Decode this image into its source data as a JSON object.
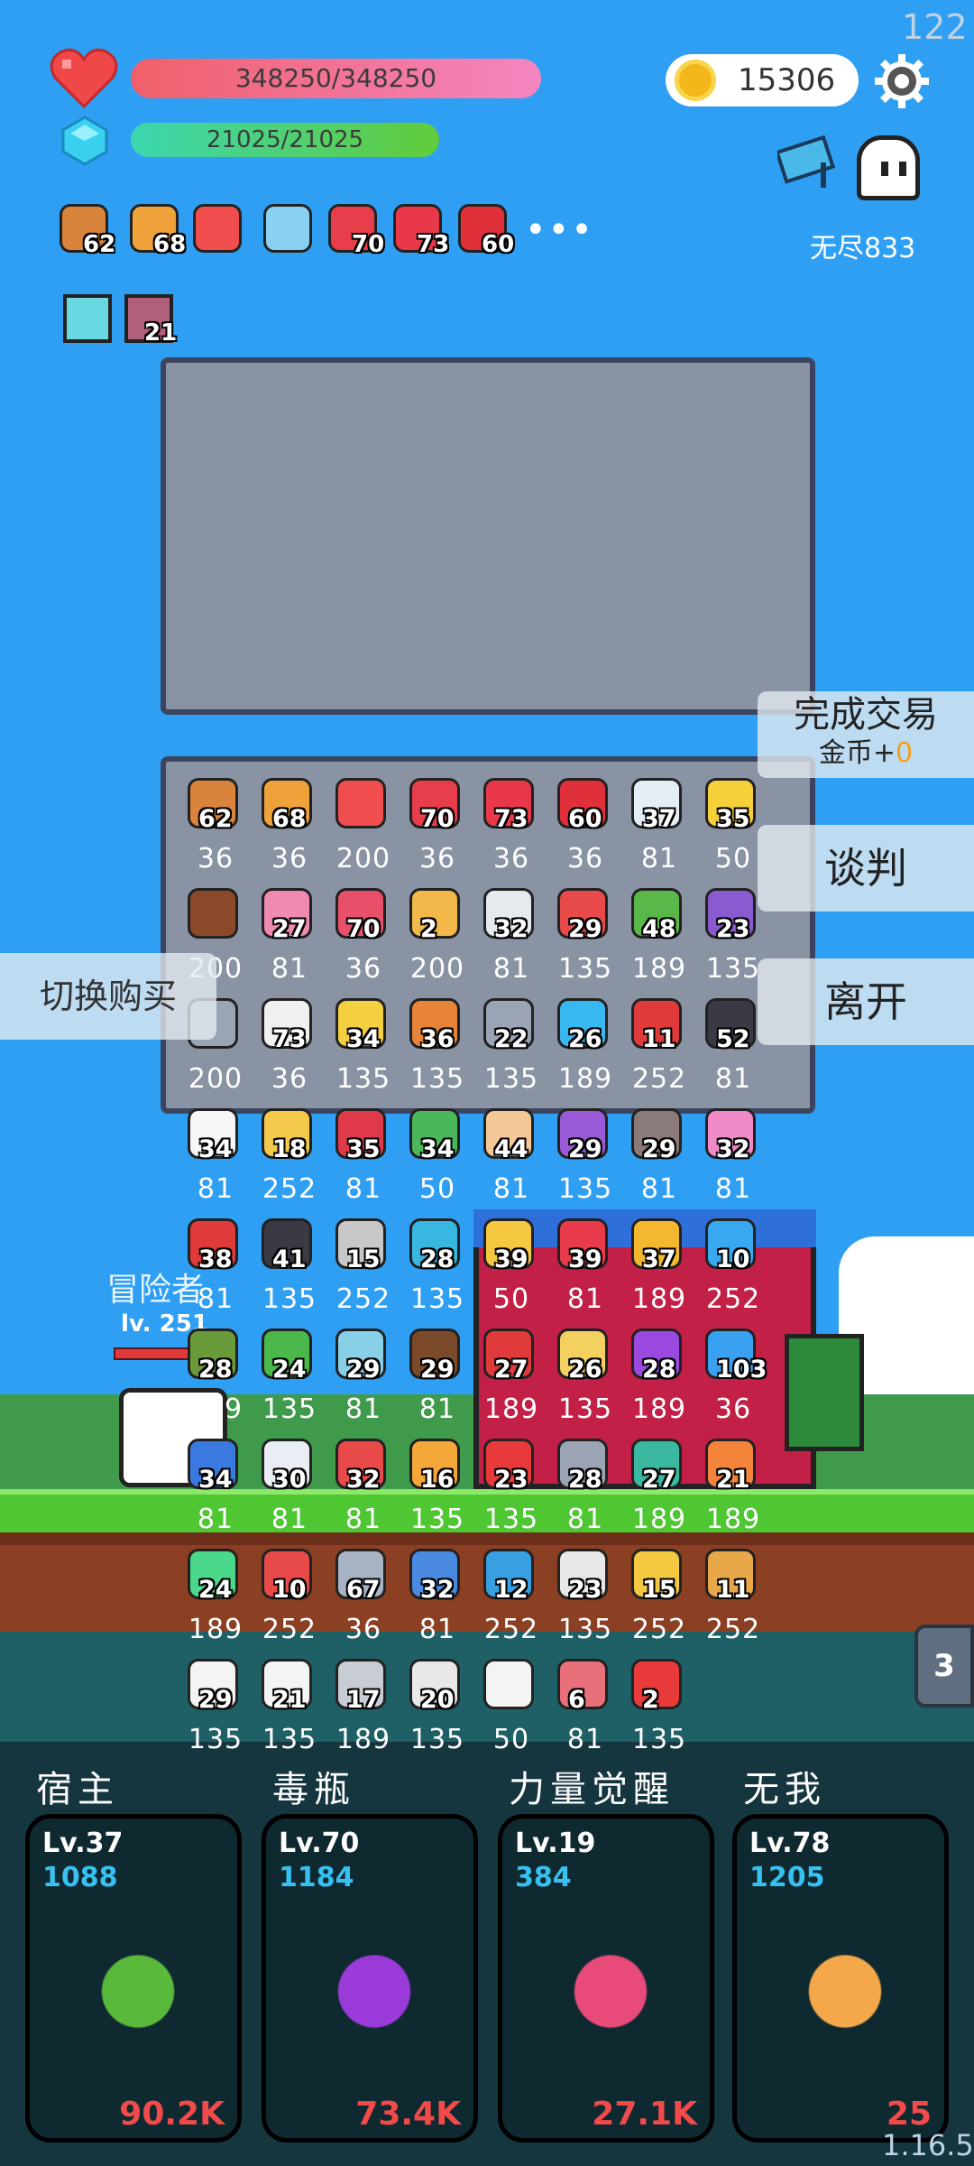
{
  "fps_counter": "122",
  "version": "1.16.5",
  "hp": {
    "text": "348250/348250",
    "current": 348250,
    "max": 348250
  },
  "mp": {
    "text": "21025/21025",
    "current": 21025,
    "max": 21025
  },
  "gold": "15306",
  "endless_label": "无尽833",
  "buffs": [
    {
      "icon": "donut-icon",
      "count": "62"
    },
    {
      "icon": "book-icon",
      "count": "68"
    },
    {
      "icon": "percent-card-icon",
      "count": ""
    },
    {
      "icon": "magnifier-icon",
      "count": ""
    },
    {
      "icon": "watermelon-icon",
      "count": "70"
    },
    {
      "icon": "sock-icon",
      "count": "73"
    },
    {
      "icon": "apple-icon",
      "count": "60"
    }
  ],
  "more_buffs": "•••",
  "status_effects": [
    {
      "icon": "lightbulb-icon",
      "count": ""
    },
    {
      "icon": "sword-card-icon",
      "count": "21"
    }
  ],
  "buttons": {
    "complete_trade": "完成交易",
    "gold_gain_prefix": "金币+",
    "gold_gain_value": "0",
    "negotiate": "谈判",
    "leave": "离开",
    "switch_buy": "切换购买"
  },
  "hero": {
    "name": "冒险者",
    "level": "lv. 251"
  },
  "stage_badge": "3",
  "shop_items": [
    [
      {
        "icon": "donut-icon",
        "count": "62",
        "price": "36",
        "color": "#d9843c"
      },
      {
        "icon": "book-icon",
        "count": "68",
        "price": "36",
        "color": "#f0a23a"
      },
      {
        "icon": "percent-card-icon",
        "count": "",
        "price": "200",
        "color": "#f04e4e"
      },
      {
        "icon": "watermelon-icon",
        "count": "70",
        "price": "36",
        "color": "#e83d4a"
      },
      {
        "icon": "sock-icon",
        "count": "73",
        "price": "36",
        "color": "#e8384a"
      },
      {
        "icon": "apple-icon",
        "count": "60",
        "price": "36",
        "color": "#e0303a"
      },
      {
        "icon": "envelope-icon",
        "count": "37",
        "price": "81",
        "color": "#e6eef5"
      },
      {
        "icon": "sun-cloud-icon",
        "count": "35",
        "price": "50",
        "color": "#f6d03a"
      }
    ],
    [
      {
        "icon": "mushroom-icon",
        "count": "",
        "price": "200",
        "color": "#8a4a2a"
      },
      {
        "icon": "perfume-icon",
        "count": "27",
        "price": "81",
        "color": "#f08ab0"
      },
      {
        "icon": "jam-jar-icon",
        "count": "70",
        "price": "36",
        "color": "#e8506a"
      },
      {
        "icon": "map-scroll-icon",
        "count": "2",
        "price": "200",
        "color": "#f2b84a"
      },
      {
        "icon": "cloud-icon",
        "count": "32",
        "price": "81",
        "color": "#e6e9ee"
      },
      {
        "icon": "pill-icon",
        "count": "29",
        "price": "135",
        "color": "#e84a4a"
      },
      {
        "icon": "green-goblin-icon",
        "count": "48",
        "price": "189",
        "color": "#5ab84a"
      },
      {
        "icon": "star-shield-icon",
        "count": "23",
        "price": "135",
        "color": "#8a5ad0"
      }
    ],
    [
      {
        "icon": "question-mark-icon",
        "count": "",
        "price": "200",
        "color": "#9aa4b4"
      },
      {
        "icon": "flower-icon",
        "count": "73",
        "price": "36",
        "color": "#f0f0f0"
      },
      {
        "icon": "halo-icon",
        "count": "34",
        "price": "135",
        "color": "#f4d040"
      },
      {
        "icon": "sword-flag-icon",
        "count": "36",
        "price": "135",
        "color": "#e8843a"
      },
      {
        "icon": "spiked-ball-icon",
        "count": "22",
        "price": "135",
        "color": "#9aa4b4"
      },
      {
        "icon": "chat-bubble-icon",
        "count": "26",
        "price": "189",
        "color": "#38b8f0"
      },
      {
        "icon": "broken-heart-icon",
        "count": "11",
        "price": "252",
        "color": "#e03a3a"
      },
      {
        "icon": "bat-icon",
        "count": "52",
        "price": "81",
        "color": "#3a3a44"
      }
    ],
    [
      {
        "icon": "fried-egg-icon",
        "count": "34",
        "price": "81",
        "color": "#f6f6f6"
      },
      {
        "icon": "magic-wand-icon",
        "count": "18",
        "price": "252",
        "color": "#f4c84a"
      },
      {
        "icon": "strawberry-icon",
        "count": "35",
        "price": "81",
        "color": "#e03a4a"
      },
      {
        "icon": "money-heart-icon",
        "count": "34",
        "price": "50",
        "color": "#4ab85a"
      },
      {
        "icon": "finger-icon",
        "count": "44",
        "price": "81",
        "color": "#f4c896"
      },
      {
        "icon": "purple-box-icon",
        "count": "29",
        "price": "135",
        "color": "#9a5ad8"
      },
      {
        "icon": "tombstone-icon",
        "count": "29",
        "price": "81",
        "color": "#8a7a7a"
      },
      {
        "icon": "ice-cream-icon",
        "count": "32",
        "price": "81",
        "color": "#f08ac8"
      }
    ],
    [
      {
        "icon": "red-mushroom-icon",
        "count": "38",
        "price": "81",
        "color": "#e03a3a"
      },
      {
        "icon": "cauldron-icon",
        "count": "41",
        "price": "135",
        "color": "#3a3a44"
      },
      {
        "icon": "hook-icon",
        "count": "15",
        "price": "252",
        "color": "#c8c8c8"
      },
      {
        "icon": "scroll-icon",
        "count": "28",
        "price": "135",
        "color": "#38b8e0"
      },
      {
        "icon": "crown-icon",
        "count": "39",
        "price": "50",
        "color": "#f4c840"
      },
      {
        "icon": "heart-icon",
        "count": "39",
        "price": "81",
        "color": "#e83a4a"
      },
      {
        "icon": "sunflower-icon",
        "count": "37",
        "price": "189",
        "color": "#f4b830"
      },
      {
        "icon": "blue-gem-icon",
        "count": "10",
        "price": "252",
        "color": "#38a8f0"
      }
    ],
    [
      {
        "icon": "grenade-icon",
        "count": "28",
        "price": "189",
        "color": "#6a9a3a"
      },
      {
        "icon": "leaf-icon",
        "count": "24",
        "price": "135",
        "color": "#4ab84a"
      },
      {
        "icon": "fish-bowl-icon",
        "count": "29",
        "price": "81",
        "color": "#88d0e8"
      },
      {
        "icon": "coconut-icon",
        "count": "29",
        "price": "81",
        "color": "#7a4a2a"
      },
      {
        "icon": "red-shield-icon",
        "count": "27",
        "price": "189",
        "color": "#e03a3a"
      },
      {
        "icon": "pencil-note-icon",
        "count": "26",
        "price": "135",
        "color": "#f4d060"
      },
      {
        "icon": "crystal-ball-icon",
        "count": "28",
        "price": "189",
        "color": "#9a4ae0"
      },
      {
        "icon": "star-badge-icon",
        "count": "103",
        "price": "36",
        "color": "#3aa0f0"
      }
    ],
    [
      {
        "icon": "capsule-icon",
        "count": "34",
        "price": "81",
        "color": "#3a7ae0"
      },
      {
        "icon": "clipboard-icon",
        "count": "30",
        "price": "81",
        "color": "#e8eef4"
      },
      {
        "icon": "thermometer-icon",
        "count": "32",
        "price": "81",
        "color": "#e84a4a"
      },
      {
        "icon": "paper-scroll-icon",
        "count": "16",
        "price": "135",
        "color": "#f4a83a"
      },
      {
        "icon": "gift-box-icon",
        "count": "23",
        "price": "135",
        "color": "#e83a3a"
      },
      {
        "icon": "butterfly-icon",
        "count": "28",
        "price": "81",
        "color": "#9aa4b4"
      },
      {
        "icon": "target-ring-icon",
        "count": "27",
        "price": "189",
        "color": "#3ab8a0"
      },
      {
        "icon": "meteor-icon",
        "count": "21",
        "price": "189",
        "color": "#f4843a"
      }
    ],
    [
      {
        "icon": "slime-icon",
        "count": "24",
        "price": "189",
        "color": "#4ad88a"
      },
      {
        "icon": "paintbrush-icon",
        "count": "10",
        "price": "252",
        "color": "#e84a4a"
      },
      {
        "icon": "sword-icon",
        "count": "67",
        "price": "36",
        "color": "#a8b4c4"
      },
      {
        "icon": "shield-icon",
        "count": "32",
        "price": "81",
        "color": "#4a8ae0"
      },
      {
        "icon": "crosshair-icon",
        "count": "12",
        "price": "252",
        "color": "#38a0e0"
      },
      {
        "icon": "stopwatch-icon",
        "count": "23",
        "price": "135",
        "color": "#e8e8e8"
      },
      {
        "icon": "ring-icon",
        "count": "15",
        "price": "252",
        "color": "#f4c840"
      },
      {
        "icon": "bow-icon",
        "count": "11",
        "price": "252",
        "color": "#e8a84a"
      }
    ],
    [
      {
        "icon": "playing-card-icon",
        "count": "29",
        "price": "135",
        "color": "#f4f4f4"
      },
      {
        "icon": "ghost-icon",
        "count": "21",
        "price": "135",
        "color": "#f4f4f4"
      },
      {
        "icon": "compass-icon",
        "count": "17",
        "price": "189",
        "color": "#c8ccd4"
      },
      {
        "icon": "dice-icon",
        "count": "20",
        "price": "135",
        "color": "#e8e8e8"
      },
      {
        "icon": "speech-bubble-icon",
        "count": "",
        "price": "50",
        "color": "#f4f4f4"
      },
      {
        "icon": "meat-icon",
        "count": "6",
        "price": "81",
        "color": "#e8707a"
      },
      {
        "icon": "bookmark-icon",
        "count": "2",
        "price": "135",
        "color": "#e83a3a"
      }
    ]
  ],
  "skills": [
    {
      "name": "宿主",
      "level": "Lv.37",
      "power": "1088",
      "value": "90.2K",
      "icon": "monster-icon",
      "color": "#5ab83a"
    },
    {
      "name": "毒瓶",
      "level": "Lv.70",
      "power": "1184",
      "value": "73.4K",
      "icon": "potion-icon",
      "color": "#9a3ad8"
    },
    {
      "name": "力量觉醒",
      "level": "Lv.19",
      "power": "384",
      "value": "27.1K",
      "icon": "test-tube-icon",
      "color": "#e84a7a"
    },
    {
      "name": "无我",
      "level": "Lv.78",
      "power": "1205",
      "value": "25",
      "icon": "eye-hand-icon",
      "color": "#f4a84a"
    }
  ]
}
